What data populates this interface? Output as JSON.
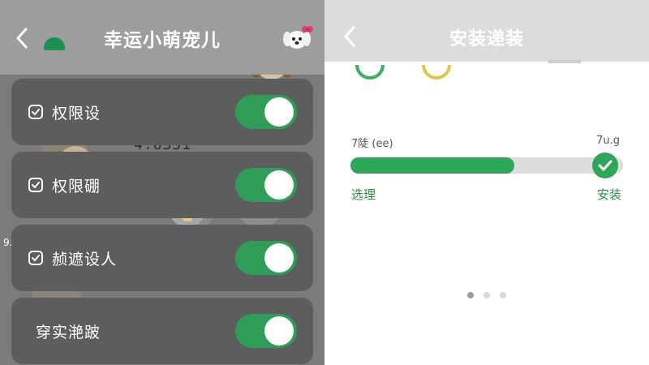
{
  "left_screen": {
    "header": {
      "back_glyph": "<",
      "title": "幸运小萌宠儿"
    },
    "background_number": "4.6351",
    "background_side_text": "9...",
    "rows": [
      {
        "label": "权限设",
        "checked": true,
        "toggle_on": true
      },
      {
        "label": "权限硼",
        "checked": true,
        "toggle_on": true
      },
      {
        "label": "赪遮设人",
        "checked": true,
        "toggle_on": true
      },
      {
        "label": "穿实滟跛",
        "checked": false,
        "toggle_on": true
      }
    ],
    "icons": [
      "chevron-left-icon",
      "check-square-icon",
      "dog-avatar-icon"
    ],
    "colors": {
      "toggle_on": "#2f9c57",
      "row_bg": "#5d5d5d",
      "header_bg": "#9d9d9d"
    }
  },
  "right_screen": {
    "header": {
      "back_glyph": "<",
      "title": "安装递装"
    },
    "progress": {
      "top_left_text": "7陡 (ee)",
      "top_right_text": "7u.g",
      "fraction": 0.6,
      "label_left": "选理",
      "label_right": "安装",
      "complete": true
    },
    "pager": {
      "count": 3,
      "active_index": 0
    },
    "icons": [
      "chevron-left-icon",
      "refresh-circle-icon",
      "yellow-ring-icon",
      "check-icon"
    ],
    "colors": {
      "accent": "#2fa55a",
      "label": "#2f8a45",
      "track": "#dddddd"
    }
  }
}
